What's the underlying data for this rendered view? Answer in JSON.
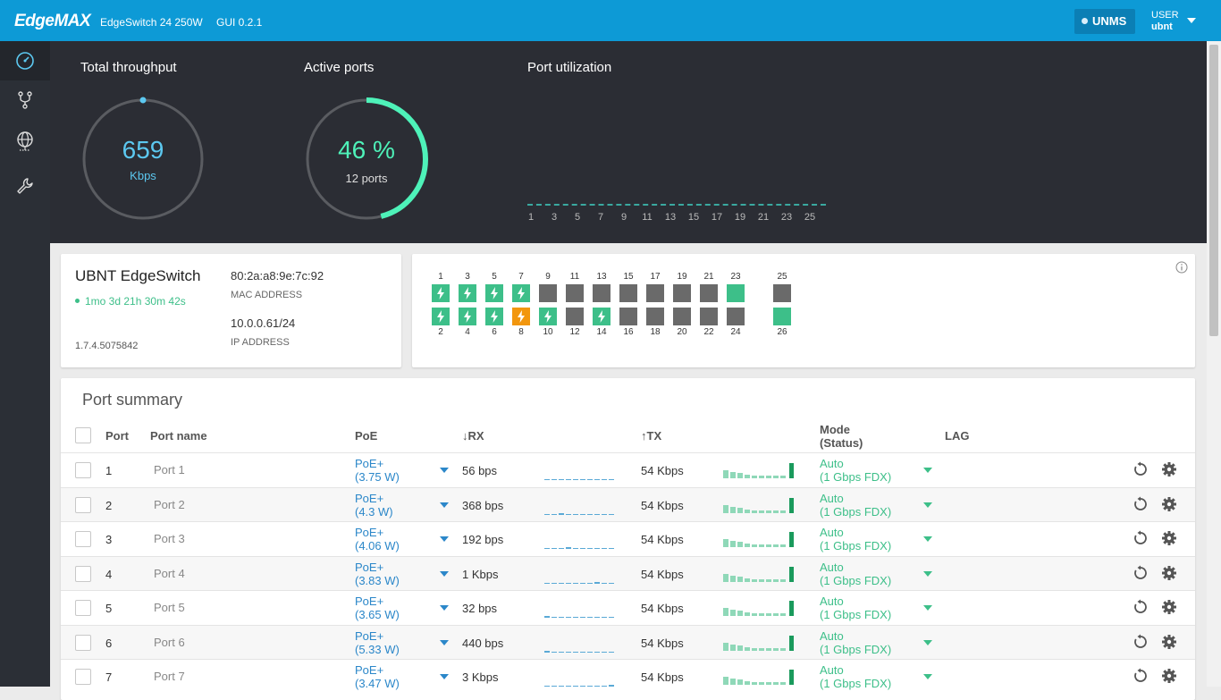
{
  "header": {
    "logo": "EdgeMAX",
    "model": "EdgeSwitch 24 250W",
    "gui_version": "GUI 0.2.1",
    "unms_label": "UNMS",
    "user_label": "USER",
    "user_name": "ubnt"
  },
  "sidebar": {
    "items": [
      {
        "icon": "dashboard-icon",
        "active": true
      },
      {
        "icon": "ports-icon"
      },
      {
        "icon": "network-icon"
      },
      {
        "icon": "tools-icon"
      }
    ]
  },
  "dashboard": {
    "throughput": {
      "title": "Total throughput",
      "value": "659",
      "unit": "Kbps"
    },
    "active_ports": {
      "title": "Active ports",
      "value": "46 %",
      "sub": "12 ports",
      "fraction": 0.46
    },
    "utilization": {
      "title": "Port utilization",
      "ticks": [
        "1",
        "3",
        "5",
        "7",
        "9",
        "11",
        "13",
        "15",
        "17",
        "19",
        "21",
        "23",
        "25"
      ]
    }
  },
  "device": {
    "name": "UBNT EdgeSwitch",
    "uptime": "1mo 3d 21h 30m 42s",
    "firmware": "1.7.4.5075842",
    "mac": "80:2a:a8:9e:7c:92",
    "mac_label": "MAC ADDRESS",
    "ip": "10.0.0.61/24",
    "ip_label": "IP ADDRESS"
  },
  "port_map": {
    "top": [
      {
        "n": "1",
        "s": "poe"
      },
      {
        "n": "3",
        "s": "poe"
      },
      {
        "n": "5",
        "s": "poe"
      },
      {
        "n": "7",
        "s": "poe"
      },
      {
        "n": "9",
        "s": "off"
      },
      {
        "n": "11",
        "s": "off"
      },
      {
        "n": "13",
        "s": "off"
      },
      {
        "n": "15",
        "s": "off"
      },
      {
        "n": "17",
        "s": "off"
      },
      {
        "n": "19",
        "s": "off"
      },
      {
        "n": "21",
        "s": "off"
      },
      {
        "n": "23",
        "s": "up"
      }
    ],
    "bottom": [
      {
        "n": "2",
        "s": "poe"
      },
      {
        "n": "4",
        "s": "poe"
      },
      {
        "n": "6",
        "s": "poe"
      },
      {
        "n": "8",
        "s": "warn"
      },
      {
        "n": "10",
        "s": "poe"
      },
      {
        "n": "12",
        "s": "off"
      },
      {
        "n": "14",
        "s": "poe"
      },
      {
        "n": "16",
        "s": "off"
      },
      {
        "n": "18",
        "s": "off"
      },
      {
        "n": "20",
        "s": "off"
      },
      {
        "n": "22",
        "s": "off"
      },
      {
        "n": "24",
        "s": "off"
      }
    ],
    "sfp": [
      {
        "n": "25",
        "s": "off"
      },
      {
        "n": "26",
        "s": "up"
      }
    ]
  },
  "port_summary": {
    "title": "Port summary",
    "headers": {
      "port": "Port",
      "name": "Port name",
      "poe": "PoE",
      "rx": "↓RX",
      "tx": "↑TX",
      "mode": "Mode",
      "mode_sub": "(Status)",
      "lag": "LAG"
    },
    "rows": [
      {
        "port": "1",
        "name": "Port 1",
        "poe": "PoE+",
        "poe_w": "(3.75 W)",
        "rx": "56 bps",
        "tx": "54 Kbps",
        "mode": "Auto",
        "status": "(1 Gbps FDX)"
      },
      {
        "port": "2",
        "name": "Port 2",
        "poe": "PoE+",
        "poe_w": "(4.3 W)",
        "rx": "368 bps",
        "tx": "54 Kbps",
        "mode": "Auto",
        "status": "(1 Gbps FDX)"
      },
      {
        "port": "3",
        "name": "Port 3",
        "poe": "PoE+",
        "poe_w": "(4.06 W)",
        "rx": "192 bps",
        "tx": "54 Kbps",
        "mode": "Auto",
        "status": "(1 Gbps FDX)"
      },
      {
        "port": "4",
        "name": "Port 4",
        "poe": "PoE+",
        "poe_w": "(3.83 W)",
        "rx": "1 Kbps",
        "tx": "54 Kbps",
        "mode": "Auto",
        "status": "(1 Gbps FDX)"
      },
      {
        "port": "5",
        "name": "Port 5",
        "poe": "PoE+",
        "poe_w": "(3.65 W)",
        "rx": "32 bps",
        "tx": "54 Kbps",
        "mode": "Auto",
        "status": "(1 Gbps FDX)"
      },
      {
        "port": "6",
        "name": "Port 6",
        "poe": "PoE+",
        "poe_w": "(5.33 W)",
        "rx": "440 bps",
        "tx": "54 Kbps",
        "mode": "Auto",
        "status": "(1 Gbps FDX)"
      },
      {
        "port": "7",
        "name": "Port 7",
        "poe": "PoE+",
        "poe_w": "(3.47 W)",
        "rx": "3 Kbps",
        "tx": "54 Kbps",
        "mode": "Auto",
        "status": "(1 Gbps FDX)"
      }
    ]
  },
  "colors": {
    "accent": "#0d9ad6",
    "green": "#3dbf89",
    "orange": "#f2960d",
    "dark": "#2b2d34",
    "blue_text": "#2b87c9"
  }
}
